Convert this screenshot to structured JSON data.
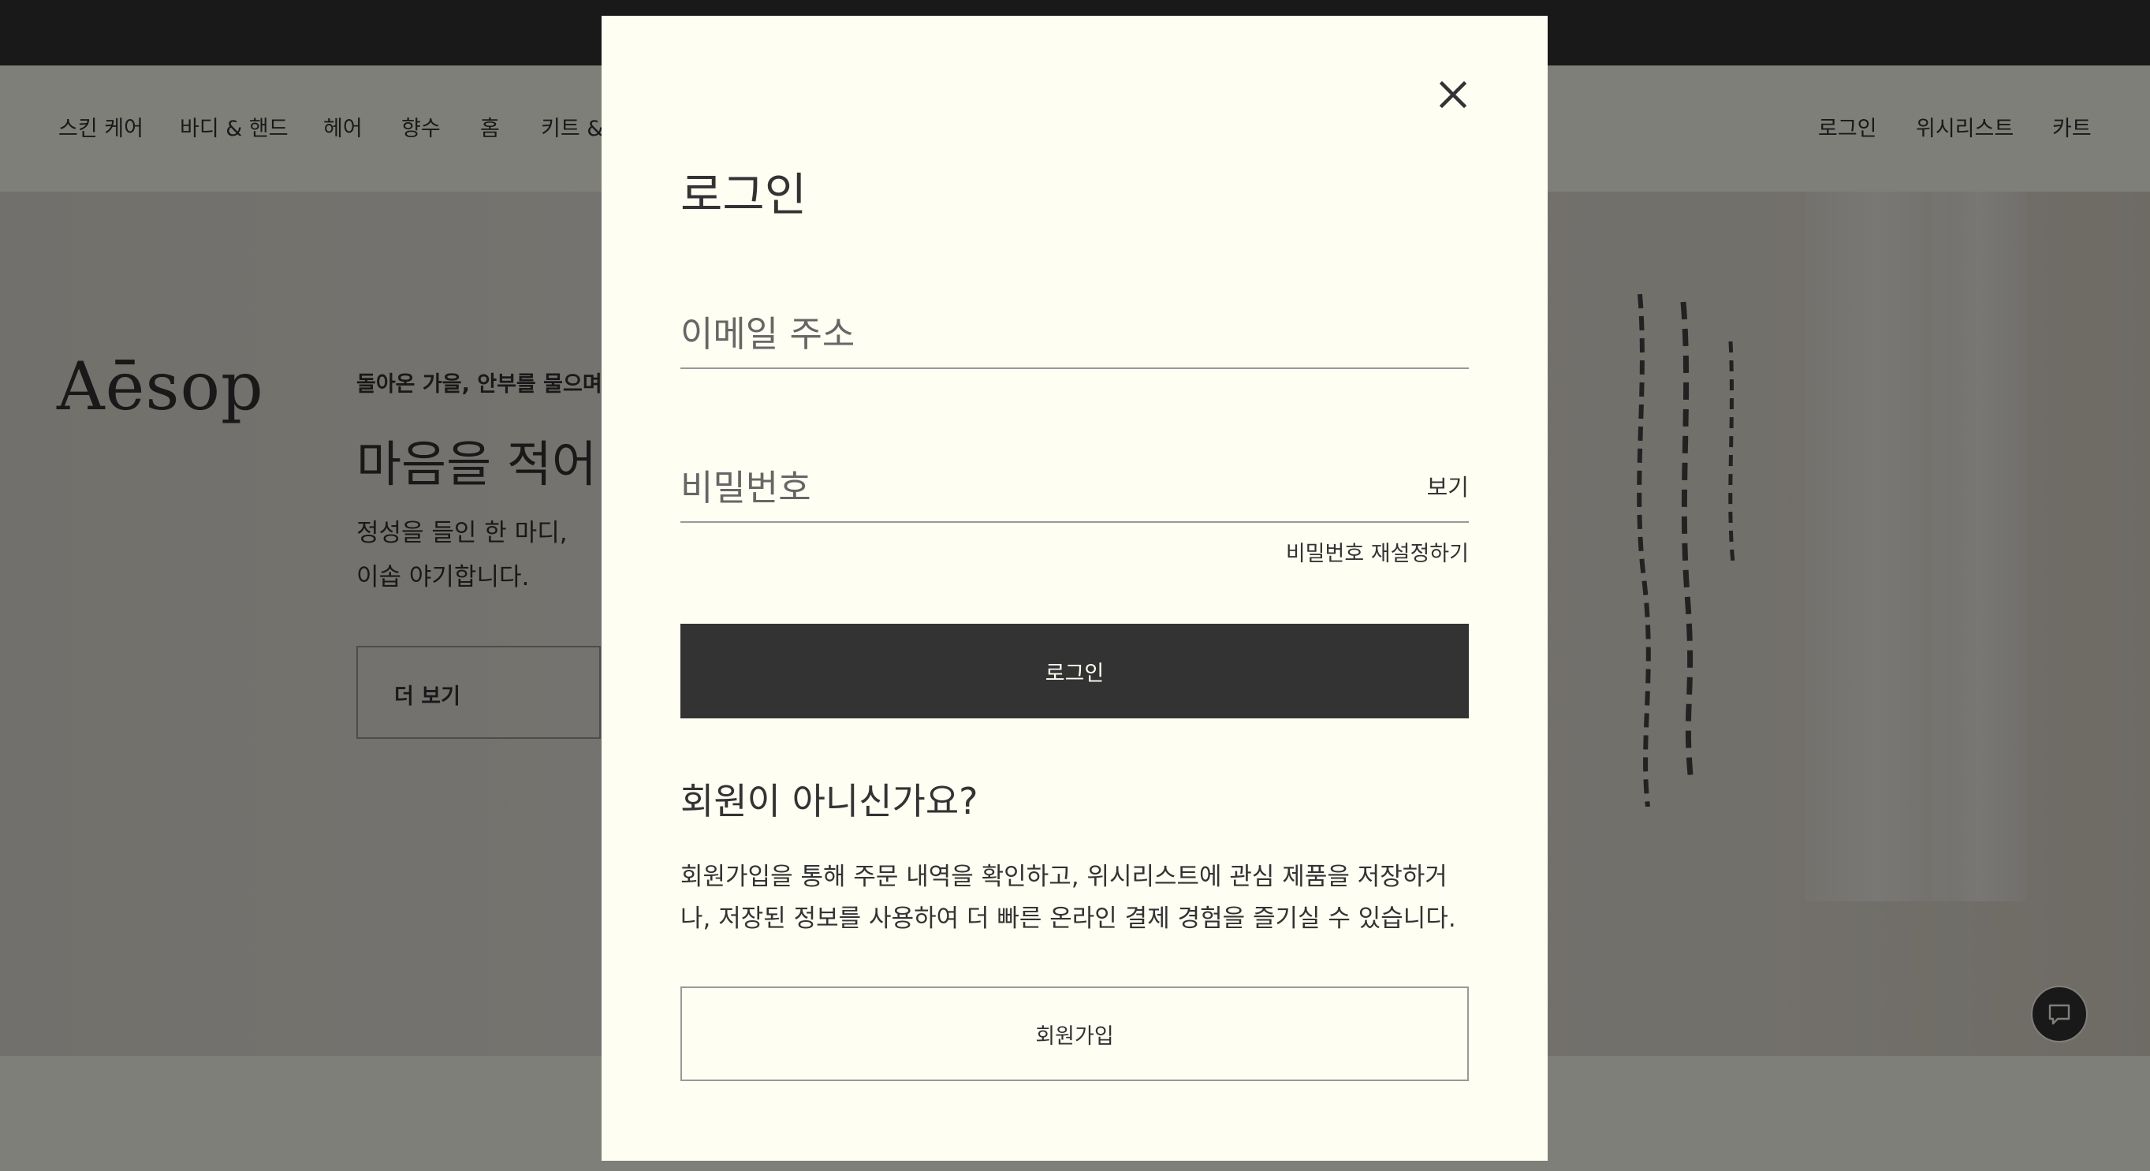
{
  "nav": {
    "left_items": [
      "스킨 케어",
      "바디 & 핸드",
      "헤어",
      "향수",
      "홈",
      "키트 &"
    ],
    "right_items": [
      "로그인",
      "위시리스트",
      "카트"
    ]
  },
  "hero": {
    "logo": "Aēsop",
    "eyebrow": "돌아온 가을, 안부를 물으며",
    "title": "마음을 적어 간",
    "body": "정성을 들인 한 마디, 이솝 야기합니다.",
    "cta_label": "더 보기"
  },
  "modal": {
    "title": "로그인",
    "email_placeholder": "이메일 주소",
    "password_placeholder": "비밀번호",
    "show_label": "보기",
    "reset_label": "비밀번호 재설정하기",
    "login_label": "로그인",
    "signup_title": "회원이 아니신가요?",
    "signup_body": "회원가입을 통해 주문 내역을 확인하고, 위시리스트에 관심 제품을 저장하거나, 저장된 정보를 사용하여 더 빠른 온라인 결제 경험을 즐기실 수 있습니다.",
    "signup_label": "회원가입"
  },
  "icons": {
    "close": "close-icon",
    "chat": "chat-icon"
  },
  "colors": {
    "background": "#fffef2",
    "primary": "#333333",
    "overlay": "rgba(0,0,0,0.5)"
  }
}
